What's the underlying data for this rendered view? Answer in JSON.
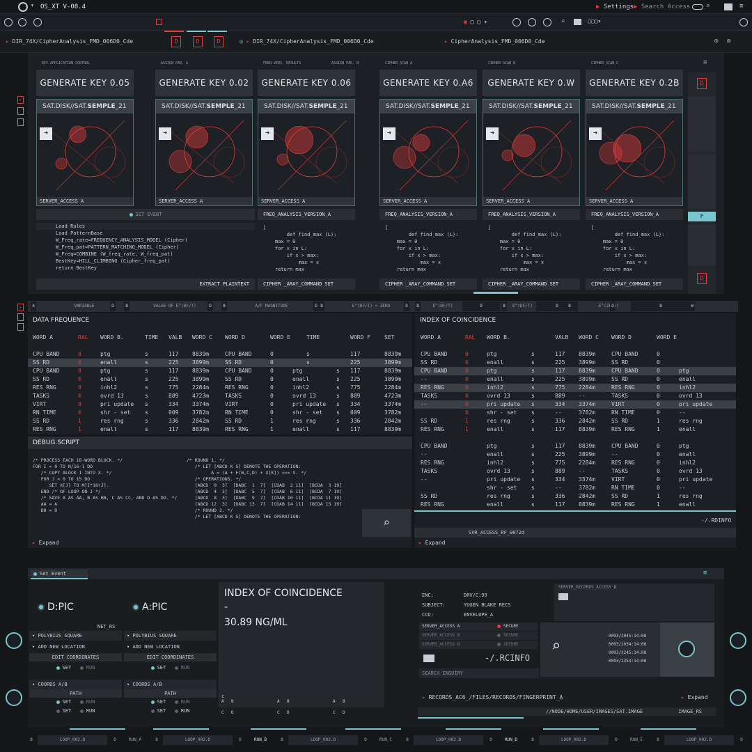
{
  "window": {
    "title": "OS_XT V-08.4",
    "settings": "Settings",
    "search_access": "Search Access"
  },
  "tabs": {
    "left_path": "DIR_74X/CipherAnalysis_FMD_006D0_Cde",
    "mid_path": "DIR_74X/CipherAnalysis_FMD_006D0_Cde",
    "right_path": "CipherAnalysis_FMD_006D0_Cde",
    "file_icon": "D"
  },
  "columns": [
    {
      "label": "KEY APPLICATION CONTROL",
      "label2": "",
      "key": "GENERATE KEY 0.05",
      "card_title_pre": "SAT.DISK//SAT.",
      "card_title_bold": "SEMPLE",
      "card_title_post": "_21",
      "foot": "SERVER_ACCESS A"
    },
    {
      "label": "ASSIGN PAR. A",
      "label2": "",
      "key": "GENERATE KEY 0.02",
      "card_title_pre": "SAT.DISK//SAT.",
      "card_title_bold": "SEMPLE",
      "card_title_post": "_21",
      "foot": "SERVER_ACCESS A"
    },
    {
      "label": "FREQ VERS. RESULTS",
      "label2": "ASSIGN PAR. B",
      "key": "GENERATE KEY 0.06",
      "card_title_pre": "SAT.DISK//SAT.",
      "card_title_bold": "SEMPLE",
      "card_title_post": "_21",
      "foot": "SERVER_ACCESS A"
    },
    {
      "label": "CIPHER SCAN A",
      "label2": "",
      "key": "GENERATE KEY 0.A6",
      "card_title_pre": "SAT.DISK//SAT.",
      "card_title_bold": "SEMPLE",
      "card_title_post": "_21",
      "foot": "SERVER_ACCESS A"
    },
    {
      "label": "CIPHER SCAN B",
      "label2": "",
      "key": "GENERATE KEY 0.W",
      "card_title_pre": "SAT.DISK//SAT.",
      "card_title_bold": "SEMPLE",
      "card_title_post": "_21",
      "foot": "SERVER_ACCESS A"
    },
    {
      "label": "CIPHER SCAN C",
      "label2": "",
      "key": "GENERATE KEY 0.2B",
      "card_title_pre": "SAT.DISK//SAT.",
      "card_title_bold": "SEMPLE",
      "card_title_post": "_21",
      "foot": "SERVER_ACCESS A"
    }
  ],
  "set_event": "SET EVENT",
  "freq_version": "FREQ_ANALYSIS_VERSION_A",
  "right_side_f": "F",
  "algorithm": [
    "Load Rules",
    "Load PatternBase",
    "W_Freq_rate=FREQUENCY_ANALYSIS_MODEL (Cipher)",
    "W_Freq_pat=PATTERN_MATCHING_MODEL (Cipher)",
    "W_Freq=COMBINE (W_freq_rate, W_freq_pat)",
    "BestKey=HILL_CLIMBING (Cipher_freq_pat)",
    "return BestKey"
  ],
  "extract_label": "EXTRACT PLAINTEXT",
  "code_snippet": [
    "[",
    "        def find_max (L):",
    "    max = 0",
    "    for x in L:",
    "        if x > max:",
    "            max = x",
    "    return max"
  ],
  "cipher_cmd": "CIPHER _ARAY_COMMAND SET",
  "var_bar": [
    "A",
    "VARIABLE",
    "D",
    "B",
    "VALUE OF E^(DF/T)",
    "D",
    "B",
    "A/F MAGNITUDE",
    "D",
    "B",
    "E^(DF/T) = ZERO",
    "D",
    "B",
    "E^(DF/T) :ONE",
    "D",
    "B",
    "E^(DF/T) :ONE",
    "D",
    "B",
    "E^(ZF/W) = ZERO",
    "D",
    "B",
    "W"
  ],
  "data_freq": {
    "title": "DATA FREQUENCE",
    "headers": [
      "WORD A",
      "RAL",
      "WORD B.",
      "TIME",
      "VALB",
      "WORD C",
      "WORD D",
      "WORD E",
      "TIME",
      "WORD F",
      "SET"
    ],
    "rows": [
      [
        "CPU BAND",
        "0",
        "ptg",
        "s",
        "117",
        "8839m",
        "CPU BAND",
        "0",
        "s",
        "117",
        "8839m"
      ],
      [
        "SS RD",
        "0",
        "enall",
        "s",
        "225",
        "3899m",
        "SS RD",
        "0",
        "s",
        "225",
        "3899m"
      ],
      [
        "CPU BAND",
        "0",
        "ptg",
        "s",
        "117",
        "8839m",
        "CPU BAND",
        "0",
        "ptg",
        "s",
        "117",
        "8839m"
      ],
      [
        "SS RD",
        "0",
        "enall",
        "s",
        "225",
        "3899m",
        "SS RD",
        "0",
        "enall",
        "s",
        "225",
        "3899m"
      ],
      [
        "RES RNG",
        "0",
        "inhl2",
        "s",
        "775",
        "2284m",
        "RES RNG",
        "0",
        "inhl2",
        "s",
        "775",
        "2284m"
      ],
      [
        "TASKS",
        "0",
        "ovrd   13",
        "s",
        "889",
        "4723m",
        "TASKS",
        "0",
        "ovrd   13",
        "s",
        "889",
        "4723m"
      ],
      [
        "VIRT",
        "0",
        "pri update",
        "s",
        "334",
        "3374m",
        "VIRT",
        "0",
        "pri update",
        "s",
        "334",
        "3374m"
      ],
      [
        "RN TIME",
        "0",
        "shr - set",
        "s",
        "009",
        "3782m",
        "RN TIME",
        "0",
        "shr - set",
        "s",
        "009",
        "3782m"
      ],
      [
        "SS RD",
        "1",
        "res rng",
        "s",
        "336",
        "2842m",
        "SS RD",
        "1",
        "res rng",
        "s",
        "336",
        "2842m"
      ],
      [
        "RES RNG",
        "1",
        "enall",
        "s",
        "117",
        "8839m",
        "RES RNG",
        "1",
        "enall",
        "s",
        "117",
        "8839m"
      ]
    ]
  },
  "debug": {
    "title": "DEBUG.SCRIPT",
    "left": [
      "/* PROCESS EACH 16-WORD BLOCK. */",
      "",
      "FOR I = 0 TO N/16-1 DO",
      "   /* COPY BLOCK I INTO X. */",
      "   FOR J = 0 TO 15 DO",
      "      SET X[J] TO M[I*16+J].",
      "   END /* OF LOOP ON J */",
      "",
      "   /* SAVE A AS AA, B AS BB, C AS CC, AND D AS DD. */",
      "   AA = A",
      "   DD = D"
    ],
    "right": [
      "/* ROUND 1. */",
      "   /* LET [ABCD K S] DENOTE THE OPERATION:",
      "         A = (A + F(B,C,D) + X[K]) <<< S. */",
      "   /* OPERATIONS. */",
      "   [ABCD  0  3]  [DABC  1  7]  [CDAB  2 11]  [BCDA  3 19]",
      "   [ABCD  4  3]  [DABC  5  7]  [CDAB  6 11]  [BCDA  7 19]",
      "   [ABCD  8  3]  [DABC  9  7]  [CDAB 10 11]  [BCDA 11 19]",
      "   [ABCD 12  3]  [DABC 13  7]  [CDAB 14 11]  [BCDA 15 19]",
      "",
      "   /* ROUND 2. */",
      "   /* LET [ABCD K S] DENOTE THE OPERATION:"
    ],
    "expand": "Expand"
  },
  "index": {
    "title": "INDEX OF COINCIDENCE",
    "headers": [
      "WORD A",
      "RAL",
      "WORD B.",
      "VALB",
      "WORD C",
      "WORD D",
      "WORD E"
    ],
    "rows": [
      [
        "CPU BAND",
        "0",
        "ptg",
        "s",
        "117",
        "8839m",
        "CPU BAND",
        "0",
        ""
      ],
      [
        "SS RD",
        "0",
        "enall",
        "s",
        "225",
        "3899m",
        "SS RD",
        "0",
        ""
      ],
      [
        "CPU BAND",
        "0",
        "ptg",
        "s",
        "117",
        "8839m",
        "CPU BAND",
        "0",
        "ptg"
      ],
      [
        "--",
        "0",
        "enall",
        "s",
        "225",
        "3899m",
        "SS RD",
        "0",
        "enall"
      ],
      [
        "RES RNG",
        "0",
        "inhl2",
        "s",
        "775",
        "2284m",
        "RES RNG",
        "0",
        "inhl2"
      ],
      [
        "TASKS",
        "0",
        "ovrd   13",
        "s",
        "889",
        "--",
        "TASKS",
        "0",
        "ovrd   13"
      ],
      [
        "--",
        "0",
        "pri update",
        "s",
        "334",
        "3374m",
        "VIRT",
        "0",
        "pri update"
      ],
      [
        "",
        "0",
        "shr - set",
        "s",
        "--",
        "3782m",
        "RN TIME",
        "0",
        "--"
      ],
      [
        "SS RD",
        "1",
        "res rng",
        "s",
        "336",
        "2842m",
        "SS RD",
        "1",
        "res rng"
      ],
      [
        "RES RNG",
        "1",
        "enall",
        "s",
        "117",
        "8839m",
        "RES RNG",
        "1",
        "enall"
      ],
      [
        "",
        "",
        "",
        "",
        "",
        "",
        "",
        "",
        ""
      ],
      [
        "CPU BAND",
        "",
        "ptg",
        "s",
        "117",
        "8839m",
        "CPU BAND",
        "0",
        "ptg"
      ],
      [
        "--",
        "",
        "enall",
        "s",
        "225",
        "3899m",
        "--",
        "0",
        "enall"
      ],
      [
        "RES RNG",
        "",
        "inhl2",
        "s",
        "775",
        "2284m",
        "RES RNG",
        "0",
        "inhl2"
      ],
      [
        "TASKS",
        "",
        "ovrd   13",
        "s",
        "889",
        "--",
        "TASKS",
        "0",
        "ovrd   13"
      ],
      [
        "--",
        "",
        "pri update",
        "s",
        "334",
        "3374m",
        "VIRT",
        "0",
        "pri update"
      ],
      [
        "",
        "",
        "shr - set",
        "s",
        "--",
        "3782m",
        "RN TIME",
        "0",
        "--"
      ],
      [
        "SS RD",
        "",
        "res rng",
        "s",
        "336",
        "2842m",
        "SS RD",
        "1",
        "res rng"
      ],
      [
        "RES RNG",
        "",
        "enall",
        "s",
        "117",
        "8839m",
        "RES RNG",
        "1",
        "enall"
      ]
    ],
    "rcinfo": "-/.RDINFO",
    "svr": "SVR_ACCESS_RF_0072d",
    "expand": "Expand"
  },
  "bottom": {
    "set_event": "Set Event",
    "dpic": "D:PIC",
    "apic": "A:PIC",
    "net": "NET_RS",
    "polybius": "POLYBIUS SQUARE",
    "add_location": "ADD NEW LOCATION",
    "edit_coords": "EDIT COORDINATES",
    "set": "SET",
    "run": "RUN",
    "coords": "COORDS A/B",
    "path": "PATH",
    "ic_title": "INDEX OF COINCIDENCE",
    "ic_dash": "-",
    "ic_value": "30.89 NG/ML",
    "ic_c": "c",
    "grid": [
      "A",
      "B",
      "A",
      "B",
      "A",
      "B",
      "C",
      "D",
      "C",
      "D",
      "C",
      "D"
    ],
    "enc_label": "ENC:",
    "enc_val": "DRV/C:99",
    "subj_label": "SUBJECT:",
    "subj_val": "YUGEN BLAKE RECS",
    "ccd_label": "CCD:",
    "ccd_val": "ENVELOPE_A",
    "server_records": "SERVER_RECORDS_ACCESS B",
    "server_rows": [
      {
        "name": "SERVER_ACCESS A",
        "status": "SECURE"
      },
      {
        "name": "SERVER_ACCESS B",
        "status": "SECURE"
      },
      {
        "name": "SERVER_ACCESS B",
        "status": "SECURE"
      }
    ],
    "rcinfo": "-/.RCINFO",
    "search_enquiry": "SEARCH ENQUIRY",
    "times": [
      "0093/2045:14:08",
      "0093/2034:14:08",
      "0093/2245:14:08",
      "0093/2354:14:08"
    ],
    "records_path": "RECORDS_AC6_/FILES/RECORDS/FINGERPRINT_A",
    "expand": "Expand",
    "node_path": "//NODE/HOME/USER/IMAGES/SAT.IMAGE",
    "image_rs": "IMAGE_RS"
  },
  "footer": [
    "B",
    "LOOP_002.D",
    "D",
    "RUN_A",
    "B",
    "LOOP_002.D",
    "D",
    "RUN_B",
    "B",
    "LOOP_002.D",
    "D",
    "RUN_C",
    "B",
    "LOOP_002.D",
    "D",
    "RUN_D",
    "B",
    "LOOP_002.D",
    "D",
    "RUN_E",
    "B",
    "LOOP_002.D",
    "D"
  ],
  "colors": {
    "accent": "#79c6cf",
    "alert": "#e33b3b",
    "panel": "#1c1f23"
  }
}
